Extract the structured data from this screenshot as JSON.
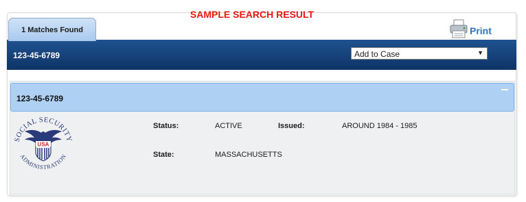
{
  "banner": {
    "title": "SAMPLE SEARCH RESULT"
  },
  "tab": {
    "label": "1 Matches Found"
  },
  "print": {
    "label": "Print",
    "icon": "printer-icon"
  },
  "header": {
    "ssn": "123-45-6789",
    "dropdown": {
      "selected": "Add to Case",
      "icon": "dropdown-arrow-icon"
    }
  },
  "record": {
    "ssn": "123-45-6789",
    "collapse_icon": "minus-icon",
    "logo": {
      "name": "social-security-administration-seal",
      "text_top": "SOCIAL SECURITY",
      "text_center": "USA",
      "text_bottom": "ADMINISTRATION"
    },
    "fields": {
      "status_label": "Status:",
      "status_value": "ACTIVE",
      "issued_label": "Issued:",
      "issued_value": "AROUND 1984 - 1985",
      "state_label": "State:",
      "state_value": "MASSACHUSETTS"
    }
  },
  "colors": {
    "title_red": "#e8170f",
    "header_navy": "#0e3466",
    "subheader_blue": "#add0f3",
    "print_blue": "#2f74b9"
  }
}
